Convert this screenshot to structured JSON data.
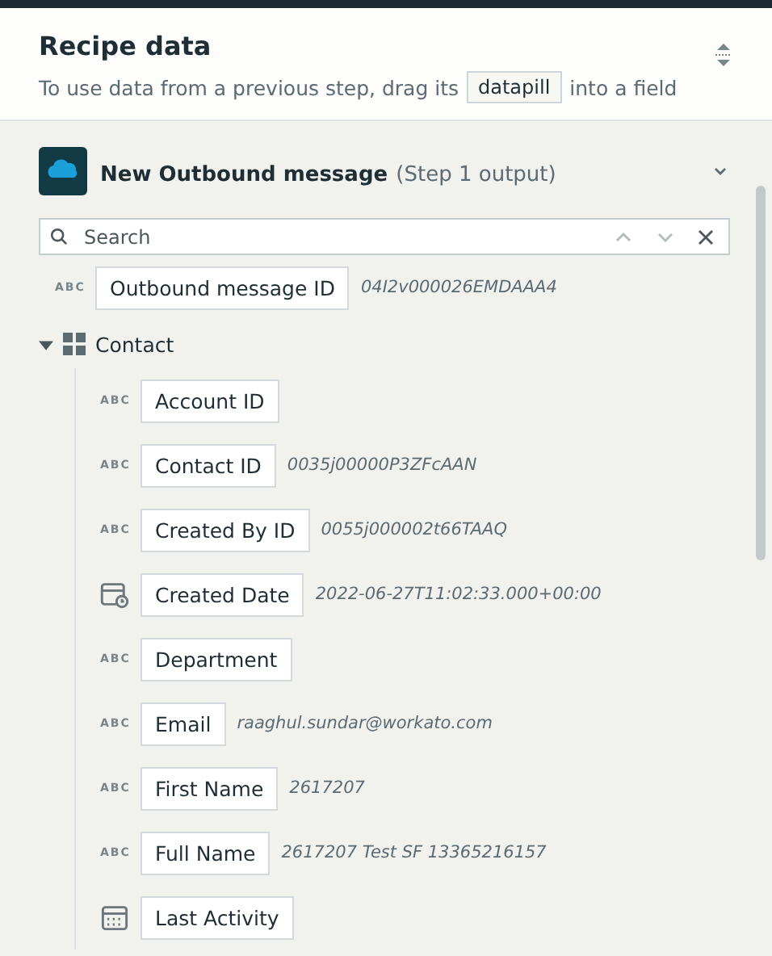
{
  "header": {
    "title": "Recipe data",
    "hint_before": "To use data from a previous step, drag its",
    "hint_pill": "datapill",
    "hint_after": "into a field"
  },
  "step": {
    "name": "New Outbound message",
    "suffix": "(Step 1 output)",
    "expanded": true
  },
  "search": {
    "placeholder": "Search"
  },
  "fields": [
    {
      "kind": "text",
      "type_label": "ABC",
      "label": "Outbound message ID",
      "value": "04I2v000026EMDAAA4"
    },
    {
      "kind": "object",
      "label": "Contact",
      "expanded": true,
      "children": [
        {
          "kind": "text",
          "type_label": "ABC",
          "label": "Account ID"
        },
        {
          "kind": "text",
          "type_label": "ABC",
          "label": "Contact ID",
          "value": "0035j00000P3ZFcAAN"
        },
        {
          "kind": "text",
          "type_label": "ABC",
          "label": "Created By ID",
          "value": "0055j000002t66TAAQ"
        },
        {
          "kind": "datetime",
          "label": "Created Date",
          "value": "2022-06-27T11:02:33.000+00:00"
        },
        {
          "kind": "text",
          "type_label": "ABC",
          "label": "Department"
        },
        {
          "kind": "text",
          "type_label": "ABC",
          "label": "Email",
          "value": "raaghul.sundar@workato.com"
        },
        {
          "kind": "text",
          "type_label": "ABC",
          "label": "First Name",
          "value": "2617207"
        },
        {
          "kind": "text",
          "type_label": "ABC",
          "label": "Full Name",
          "value": "2617207 Test SF 13365216157"
        },
        {
          "kind": "date",
          "label": "Last Activity"
        }
      ]
    }
  ]
}
